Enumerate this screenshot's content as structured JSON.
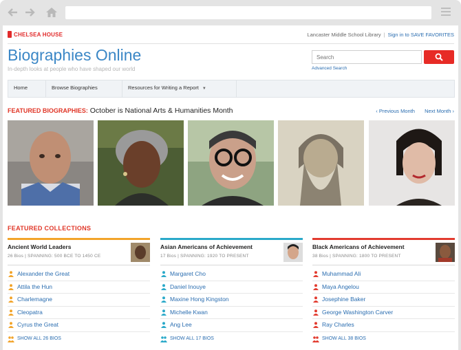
{
  "brand": {
    "name": "CHELSEA HOUSE"
  },
  "toplinks": {
    "library": "Lancaster Middle School Library",
    "signin": "Sign in to SAVE FAVORITES"
  },
  "site": {
    "title": "Biographies Online",
    "tagline": "In-depth looks at people who have shaped our world"
  },
  "search": {
    "placeholder": "Search",
    "advanced": "Advanced Search"
  },
  "nav": [
    {
      "label": "Home"
    },
    {
      "label": "Browse Biographies"
    },
    {
      "label": "Resources for Writing a Report"
    }
  ],
  "featured": {
    "label": "FEATURED BIOGRAPHIES:",
    "text": "October is National Arts & Humanities Month",
    "prev": "‹ Previous Month",
    "next": "Next Month ›"
  },
  "collections_heading": "FEATURED COLLECTIONS",
  "collections": [
    {
      "title": "Ancient World Leaders",
      "sub": "26 Bios | SPANNING: 500 BCE TO 1450 CE",
      "color": "#f2a42a",
      "items": [
        "Alexander the Great",
        "Attila the Hun",
        "Charlemagne",
        "Cleopatra",
        "Cyrus the Great"
      ],
      "show_all": "SHOW ALL 26 BIOS"
    },
    {
      "title": "Asian Americans of Achievement",
      "sub": "17 Bios | SPANNING: 1920 TO PRESENT",
      "color": "#2aa9c9",
      "items": [
        "Margaret Cho",
        "Daniel Inouye",
        "Maxine Hong Kingston",
        "Michelle Kwan",
        "Ang Lee"
      ],
      "show_all": "SHOW ALL 17 BIOS"
    },
    {
      "title": "Black Americans of Achievement",
      "sub": "38 Bios | SPANNING: 1800 TO PRESENT",
      "color": "#e23b2f",
      "items": [
        "Muhammad Ali",
        "Maya Angelou",
        "Josephine Baker",
        "George Washington Carver",
        "Ray Charles"
      ],
      "show_all": "SHOW ALL 38 BIOS"
    }
  ]
}
